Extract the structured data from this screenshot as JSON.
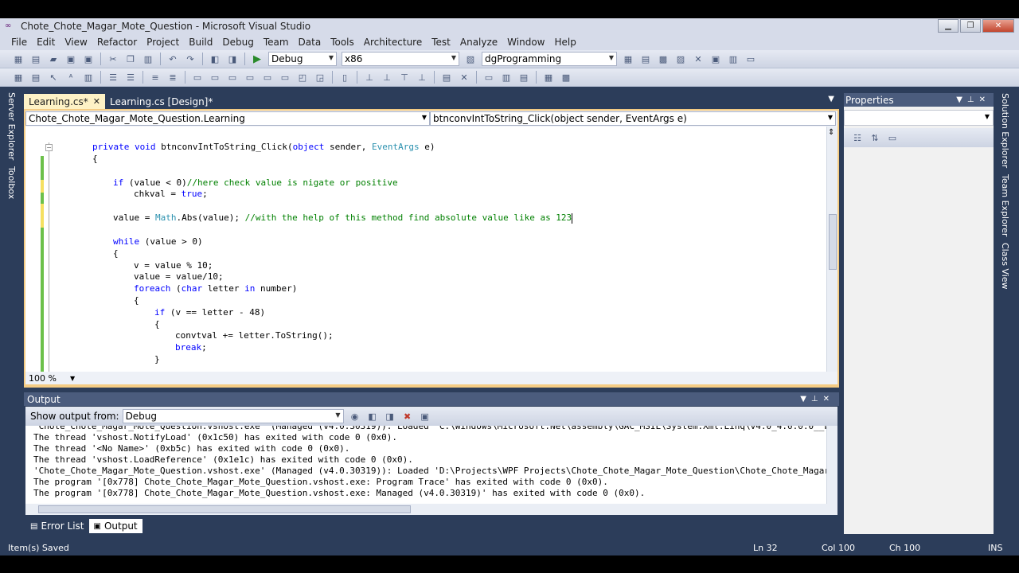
{
  "window": {
    "title": "Chote_Chote_Magar_Mote_Question - Microsoft Visual Studio",
    "controls": {
      "minimize": "▁",
      "maximize": "❐",
      "close": "✕"
    }
  },
  "menu": [
    "File",
    "Edit",
    "View",
    "Refactor",
    "Project",
    "Build",
    "Debug",
    "Team",
    "Data",
    "Tools",
    "Architecture",
    "Test",
    "Analyze",
    "Window",
    "Help"
  ],
  "toolbar": {
    "configuration": "Debug",
    "platform": "x86",
    "find_value": "dgProgramming"
  },
  "left_side_tabs": [
    "Server Explorer",
    "Toolbox"
  ],
  "right_side_tabs": [
    "Solution Explorer",
    "Team Explorer",
    "Class View"
  ],
  "document_tabs": [
    {
      "label": "Learning.cs*",
      "active": true,
      "close": "✕"
    },
    {
      "label": "Learning.cs [Design]*",
      "active": false
    }
  ],
  "editor": {
    "type_selector": "Chote_Chote_Magar_Mote_Question.Learning",
    "member_selector": "btnconvIntToString_Click(object sender, EventArgs e)",
    "zoom": "100 %",
    "code": {
      "l1_kw": "private void ",
      "l1_name": "btnconvIntToString_Click(",
      "l1_kw2": "object",
      "l1_mid": " sender, ",
      "l1_type": "EventArgs",
      "l1_end": " e)",
      "l2": "{",
      "l3_kw": "if",
      "l3_rest": " (value < 0)",
      "l3_cm": "//here check value is nigate or positive",
      "l4_a": "chkval = ",
      "l4_kw": "true",
      "l4_b": ";",
      "l5_a": "value = ",
      "l5_type": "Math",
      "l5_b": ".Abs(value); ",
      "l5_cm": "//with the help of this method find absolute value like as 123",
      "l6_kw": "while",
      "l6_rest": " (value > 0)",
      "l7": "{",
      "l8": "v = value % 10;",
      "l9": "value = value/10;",
      "l10_kw": "foreach",
      "l10_a": " (",
      "l10_kw2": "char",
      "l10_b": " letter ",
      "l10_kw3": "in",
      "l10_c": " number)",
      "l11": "{",
      "l12_kw": "if",
      "l12_rest": " (v == letter - 48)",
      "l13": "{",
      "l14": "convtval += letter.ToString();",
      "l15_kw": "break",
      "l15_b": ";",
      "l16": "}"
    }
  },
  "output": {
    "title": "Output",
    "show_from_label": "Show output from:",
    "show_from_value": "Debug",
    "lines": [
      "'Chote_Chote_Magar_Mote_Question.vshost.exe' (Managed (v4.0.30319)): Loaded 'C:\\Windows\\Microsoft.Net\\assembly\\GAC_MSIL\\System.Xml.Linq\\v4.0_4.0.0.0__b77a5c561934e089\\System.Xml.Linq.dll'",
      "The thread 'vshost.NotifyLoad' (0x1c50) has exited with code 0 (0x0).",
      "The thread '<No Name>' (0xb5c) has exited with code 0 (0x0).",
      "The thread 'vshost.LoadReference' (0x1e1c) has exited with code 0 (0x0).",
      "'Chote_Chote_Magar_Mote_Question.vshost.exe' (Managed (v4.0.30319)): Loaded 'D:\\Projects\\WPF Projects\\Chote_Chote_Magar_Mote_Question\\Chote_Chote_Magar_M",
      "The program '[0x778] Chote_Chote_Magar_Mote_Question.vshost.exe: Program Trace' has exited with code 0 (0x0).",
      "The program '[0x778] Chote_Chote_Magar_Mote_Question.vshost.exe: Managed (v4.0.30319)' has exited with code 0 (0x0)."
    ]
  },
  "bottom_tabs": [
    {
      "label": "Error List",
      "active": false
    },
    {
      "label": "Output",
      "active": true
    }
  ],
  "properties": {
    "title": "Properties"
  },
  "status": {
    "message": "Item(s) Saved",
    "ln": "Ln 32",
    "col": "Col 100",
    "ch": "Ch 100",
    "mode": "INS"
  },
  "colors": {
    "frame": "#2c3d5a",
    "active_tab": "#fef2c6",
    "keyword": "#0000ff",
    "type": "#2b91af",
    "comment": "#008000"
  }
}
